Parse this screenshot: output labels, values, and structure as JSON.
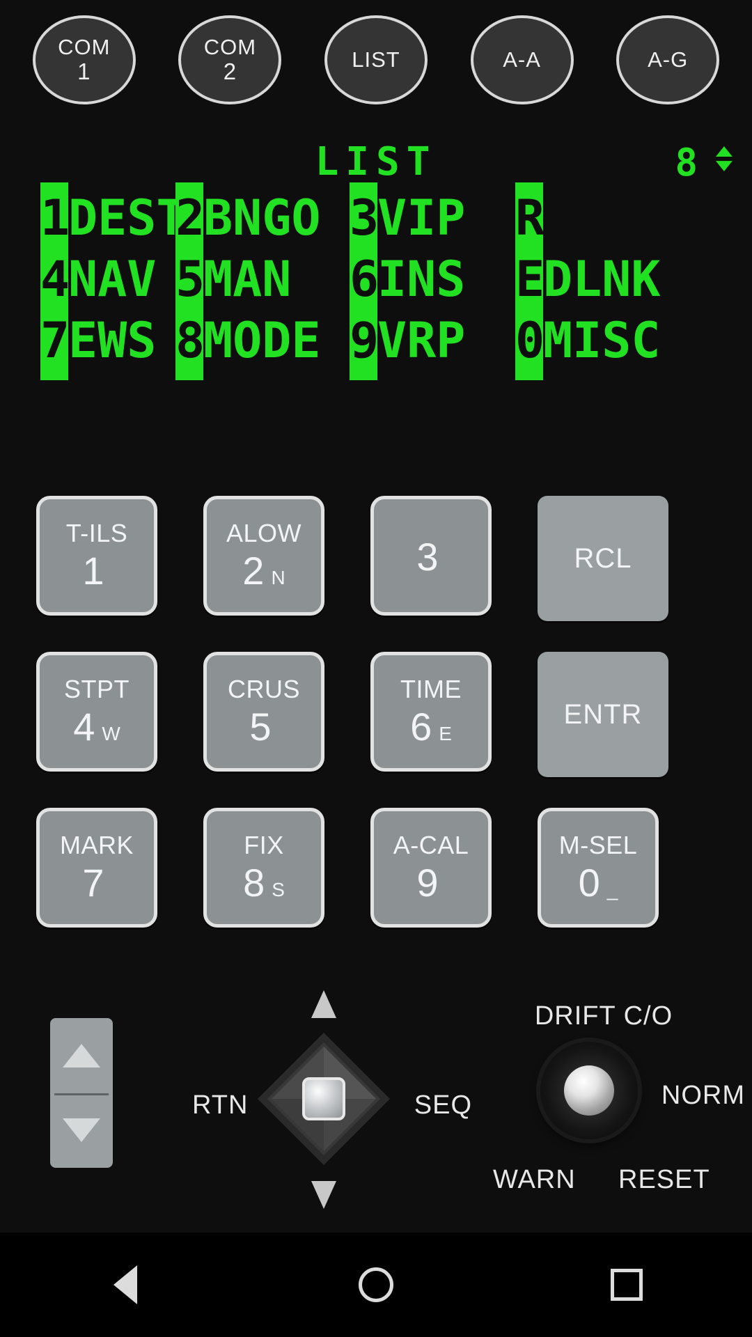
{
  "top_buttons": [
    {
      "line1": "COM",
      "line2": "1",
      "name": "com-1"
    },
    {
      "line1": "COM",
      "line2": "2",
      "name": "com-2"
    },
    {
      "line1": "LIST",
      "line2": "",
      "name": "list"
    },
    {
      "line1": "A-A",
      "line2": "",
      "name": "a-a"
    },
    {
      "line1": "A-G",
      "line2": "",
      "name": "a-g"
    }
  ],
  "display": {
    "title": "LIST",
    "page": "8",
    "up_arrow": "▲",
    "down_arrow": "▼",
    "color_text": "#22e022",
    "color_background": "#0e0e0e",
    "rows": [
      [
        {
          "key": "1",
          "label": "DEST"
        },
        {
          "key": "2",
          "label": "BNGO"
        },
        {
          "key": "3",
          "label": "VIP"
        },
        {
          "key": "R",
          "label": ""
        }
      ],
      [
        {
          "key": "4",
          "label": "NAV"
        },
        {
          "key": "5",
          "label": "MAN"
        },
        {
          "key": "6",
          "label": "INS"
        },
        {
          "key": "E",
          "label": "DLNK"
        }
      ],
      [
        {
          "key": "7",
          "label": "EWS"
        },
        {
          "key": "8",
          "label": "MODE"
        },
        {
          "key": "9",
          "label": "VRP"
        },
        {
          "key": "0",
          "label": "MISC"
        }
      ]
    ]
  },
  "keypad": {
    "rows": [
      [
        {
          "top": "T-ILS",
          "num": "1",
          "sub": "",
          "name": "key-1-tils"
        },
        {
          "top": "ALOW",
          "num": "2",
          "sub": "N",
          "name": "key-2-alow"
        },
        {
          "top": "",
          "num": "3",
          "sub": "",
          "name": "key-3"
        },
        {
          "top": "RCL",
          "num": "",
          "sub": "",
          "name": "key-rcl",
          "wide": true
        }
      ],
      [
        {
          "top": "STPT",
          "num": "4",
          "sub": "W",
          "name": "key-4-stpt"
        },
        {
          "top": "CRUS",
          "num": "5",
          "sub": "",
          "name": "key-5-crus"
        },
        {
          "top": "TIME",
          "num": "6",
          "sub": "E",
          "name": "key-6-time"
        },
        {
          "top": "ENTR",
          "num": "",
          "sub": "",
          "name": "key-entr",
          "wide": true
        }
      ],
      [
        {
          "top": "MARK",
          "num": "7",
          "sub": "",
          "name": "key-7-mark"
        },
        {
          "top": "FIX",
          "num": "8",
          "sub": "S",
          "name": "key-8-fix"
        },
        {
          "top": "A-CAL",
          "num": "9",
          "sub": "",
          "name": "key-9-acal"
        },
        {
          "top": "M-SEL",
          "num": "0",
          "sub": "_",
          "name": "key-0-msel"
        }
      ]
    ]
  },
  "bottom": {
    "hat": {
      "left_label": "RTN",
      "right_label": "SEQ"
    },
    "drift": {
      "top_label": "DRIFT C/O",
      "right_label": "NORM",
      "bottom_left_label": "WARN",
      "bottom_right_label": "RESET"
    }
  }
}
